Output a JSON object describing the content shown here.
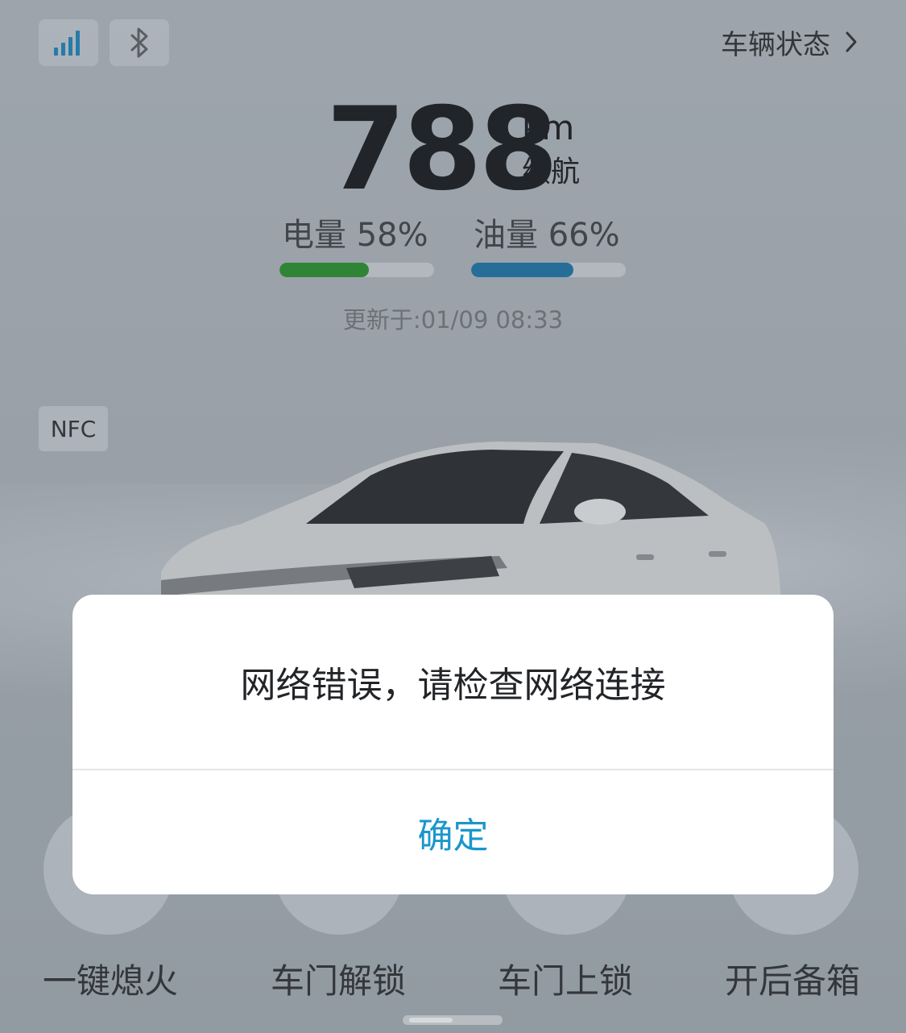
{
  "header": {
    "vehicle_status": "车辆状态",
    "icons": {
      "signal": "signal-bars-icon",
      "bluetooth": "bluetooth-icon",
      "chevron": "chevron-right-icon"
    }
  },
  "range": {
    "value": "788",
    "unit": "km",
    "label": "续航"
  },
  "meters": {
    "electric": {
      "label": "电量 58%",
      "percent": 58,
      "color": "#2a8a2f"
    },
    "fuel": {
      "label": "油量 66%",
      "percent": 66,
      "color": "#1f70a0"
    }
  },
  "updated": "更新于:01/09 08:33",
  "nfc": "NFC",
  "actions": [
    {
      "label": "一键熄火"
    },
    {
      "label": "车门解锁"
    },
    {
      "label": "车门上锁"
    },
    {
      "label": "开后备箱"
    }
  ],
  "dialog": {
    "message": "网络错误，请检查网络连接",
    "confirm": "确定",
    "accent": "#1a96cc"
  }
}
